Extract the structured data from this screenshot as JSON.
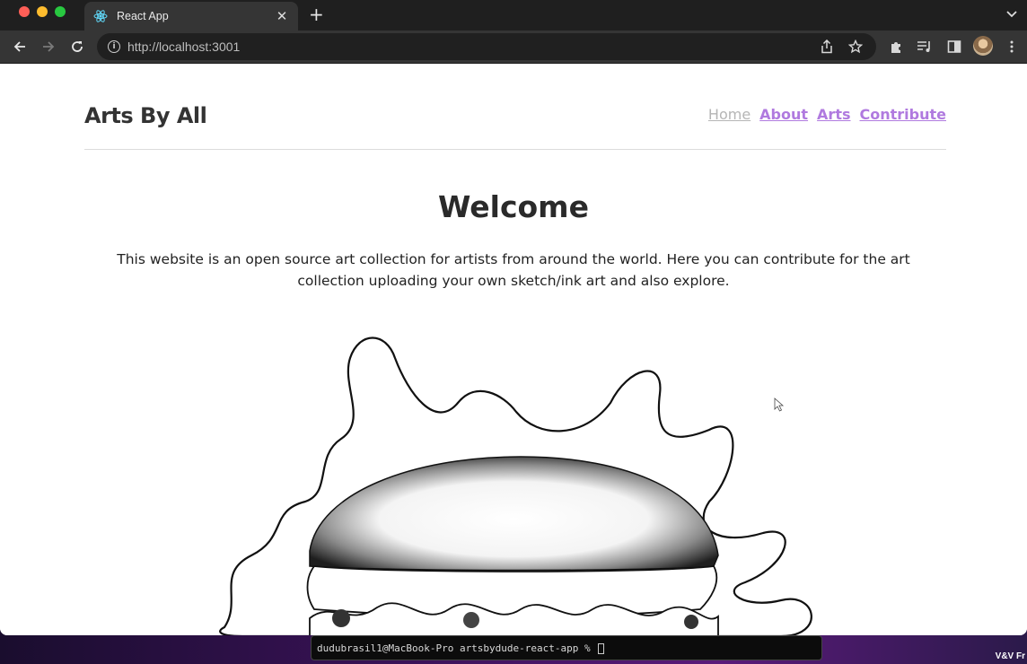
{
  "browser": {
    "tab_title": "React App",
    "url": "http://localhost:3001",
    "icons": {
      "favicon": "react-logo-icon",
      "close": "close-icon",
      "new_tab": "plus-icon",
      "tab_menu": "chevron-down-icon",
      "back": "back-arrow-icon",
      "forward": "forward-arrow-icon",
      "reload": "reload-icon",
      "site_info": "info-icon",
      "share": "share-icon",
      "bookmark": "star-icon",
      "extensions": "puzzle-icon",
      "reading_list": "media-queue-icon",
      "side_panel": "side-panel-icon",
      "menu": "kebab-menu-icon"
    }
  },
  "site": {
    "title": "Arts By All",
    "nav": {
      "home": "Home",
      "about": "About",
      "arts": "Arts",
      "contribute": "Contribute"
    },
    "welcome": {
      "heading": "Welcome",
      "text": "This website is an open source art collection for artists from around the world. Here you can contribute for the art collection uploading your own sketch/ink art and also explore."
    },
    "colors": {
      "nav_link": "#b07adf",
      "nav_active": "#b5b5b5",
      "heading": "#2a2a2a"
    }
  },
  "desktop": {
    "terminal_prompt": "dudubrasil1@MacBook-Pro artsbydude-react-app % ",
    "corner_label": "V&V Fr"
  }
}
